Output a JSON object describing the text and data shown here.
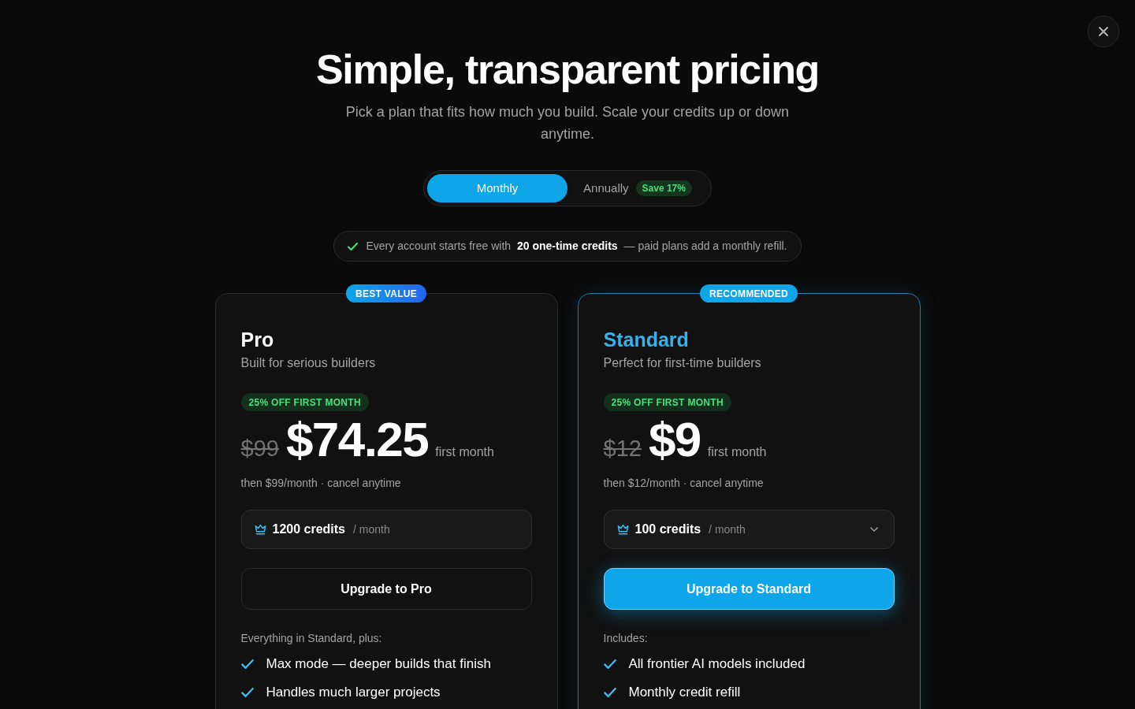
{
  "header": {
    "title": "Simple, transparent pricing",
    "subtitle": "Pick a plan that fits how much you build. Scale your credits up or down anytime."
  },
  "billing_toggle": [
    {
      "label": "Monthly",
      "selected": true
    },
    {
      "label": "Annually",
      "selected": false,
      "badge": "Save 17%"
    }
  ],
  "notice": {
    "text": "Every account starts free with **20 one-time credits** — paid plans add a monthly refill."
  },
  "plans": [
    {
      "name": "Pro",
      "ribbon": "BEST VALUE",
      "highlighted": false,
      "tagline": "Built for serious builders",
      "discount": "25% OFF FIRST MONTH",
      "old_price": "$99",
      "price": "$74.25",
      "price_note": "first month",
      "renewal": "then $99/month · cancel anytime",
      "credits": {
        "amount": "1200 credits",
        "unit": "/ month",
        "dropdown": false
      },
      "button": "Upgrade to Pro",
      "features_heading": "Everything in Standard, plus:",
      "features": [
        "Max mode — deeper builds that finish",
        "Handles much larger projects"
      ]
    },
    {
      "name": "Standard",
      "ribbon": "RECOMMENDED",
      "highlighted": true,
      "tagline": "Perfect for first-time builders",
      "discount": "25% OFF FIRST MONTH",
      "old_price": "$12",
      "price": "$9",
      "price_note": "first month",
      "renewal": "then $12/month · cancel anytime",
      "credits": {
        "amount": "100 credits",
        "unit": "/ month",
        "dropdown": true
      },
      "button": "Upgrade to Standard",
      "features_heading": "Includes:",
      "features": [
        "All frontier AI models included",
        "Monthly credit refill"
      ]
    }
  ]
}
